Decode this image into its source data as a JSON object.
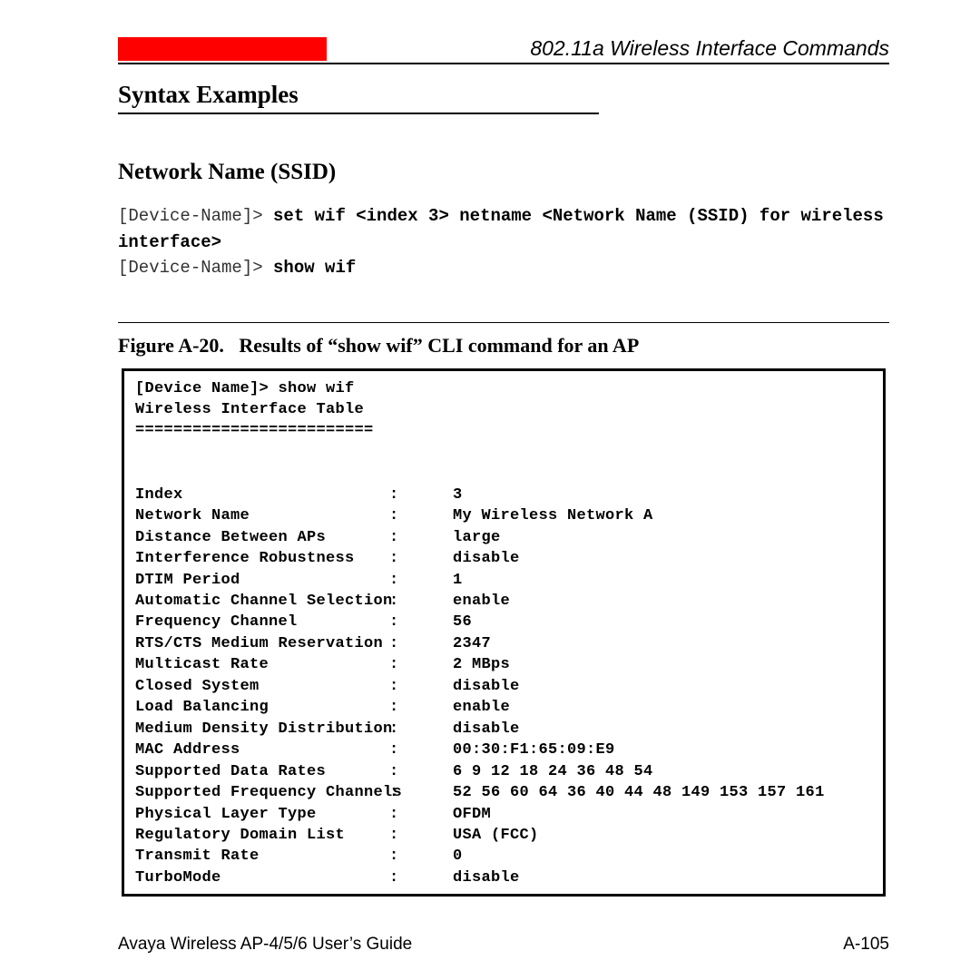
{
  "header": {
    "title": "802.11a Wireless Interface Commands"
  },
  "section_heading": "Syntax Examples",
  "sub_heading": "Network Name (SSID)",
  "cli": {
    "prompt1": "[Device-Name]> ",
    "cmd1": "set wif <index 3> netname <Network Name (SSID) for wireless interface>",
    "prompt2": "[Device-Name]> ",
    "cmd2": "show wif"
  },
  "figure": {
    "label": "Figure A-20.",
    "caption": "Results of “show wif” CLI command for an AP"
  },
  "terminal": {
    "preamble": [
      "[Device Name]> show wif",
      "Wireless Interface Table",
      "========================="
    ],
    "rows": [
      {
        "label": "Index",
        "value": "3"
      },
      {
        "label": "Network Name",
        "value": "My Wireless Network A"
      },
      {
        "label": "Distance Between APs",
        "value": "large"
      },
      {
        "label": "Interference Robustness",
        "value": "disable"
      },
      {
        "label": "DTIM Period",
        "value": "1"
      },
      {
        "label": "Automatic Channel Selection",
        "value": "enable"
      },
      {
        "label": "Frequency Channel",
        "value": "56"
      },
      {
        "label": "RTS/CTS Medium Reservation",
        "value": "2347"
      },
      {
        "label": "Multicast Rate",
        "value": "2 MBps"
      },
      {
        "label": "Closed System",
        "value": "disable"
      },
      {
        "label": "Load Balancing",
        "value": "enable"
      },
      {
        "label": "Medium Density Distribution",
        "value": "disable"
      },
      {
        "label": "MAC Address",
        "value": "00:30:F1:65:09:E9"
      },
      {
        "label": "Supported Data Rates",
        "value": "6 9 12 18 24 36 48 54"
      },
      {
        "label": "Supported Frequency Channels",
        "value": "52 56 60 64 36 40 44 48 149 153 157 161"
      },
      {
        "label": "Physical Layer Type",
        "value": "OFDM"
      },
      {
        "label": "Regulatory Domain List",
        "value": "USA (FCC)"
      },
      {
        "label": "Transmit Rate",
        "value": "0"
      },
      {
        "label": "TurboMode",
        "value": "disable"
      }
    ]
  },
  "footer": {
    "left": "Avaya Wireless AP-4/5/6 User’s Guide",
    "right": "A-105"
  }
}
